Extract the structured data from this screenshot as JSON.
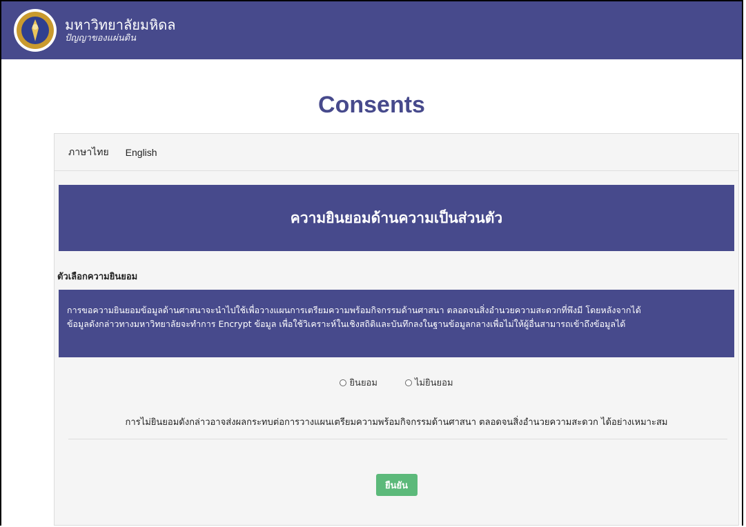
{
  "header": {
    "university_name": "มหาวิทยาลัยมหิดล",
    "university_motto": "ปัญญาของแผ่นดิน"
  },
  "page": {
    "title": "Consents"
  },
  "language_tabs": [
    {
      "label": "ภาษาไทย"
    },
    {
      "label": "English"
    }
  ],
  "consent": {
    "heading": "ความยินยอมด้านความเป็นส่วนตัว",
    "options_label": "ตัวเลือกความยินยอม",
    "description_line1": "การขอความยินยอมข้อมูลด้านศาสนาจะนำไปใช้เพื่อวางแผนการเตรียมความพร้อมกิจกรรมด้านศาสนา ตลอดจนสิ่งอำนวยความสะดวกที่พึงมี โดยหลังจากได้",
    "description_line2": "ข้อมูลดังกล่าวทางมหาวิทยาลัยจะทำการ Encrypt ข้อมูล เพื่อใช้วิเคราะห์ในเชิงสถิติและบันทึกลงในฐานข้อมูลกลางเพื่อไม่ให้ผู้อื่นสามารถเข้าถึงข้อมูลได้",
    "options": [
      {
        "label": "ยินยอม"
      },
      {
        "label": "ไม่ยินยอม"
      }
    ],
    "notice": "การไม่ยินยอมดังกล่าวอาจส่งผลกระทบต่อการวางแผนเตรียมความพร้อมกิจกรรมด้านศาสนา ตลอดจนสิ่งอำนวยความสะดวก ได้อย่างเหมาะสม",
    "confirm_label": "ยืนยัน"
  },
  "colors": {
    "primary": "#474a8c",
    "confirm": "#5cb97a",
    "card_bg": "#f5f5f5"
  }
}
